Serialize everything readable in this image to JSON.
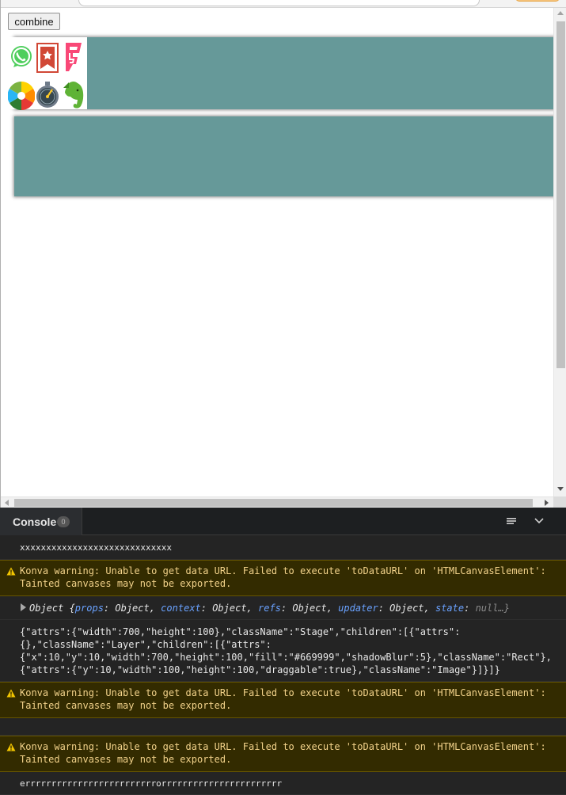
{
  "preview": {
    "combine_button_label": "combine",
    "canvas_rect_color": "#669999",
    "icons": [
      "whatsapp-icon",
      "wunderlist-icon",
      "foursquare-icon",
      "pinwheel-icon",
      "clock-icon",
      "evernote-icon"
    ]
  },
  "console": {
    "title": "Console",
    "count": "0",
    "messages": [
      {
        "type": "log",
        "text": "xxxxxxxxxxxxxxxxxxxxxxxxxxxxx"
      },
      {
        "type": "warn",
        "line1": "Konva warning: Unable to get data URL. Failed to execute 'toDataURL' on 'HTMLCanvasElement':",
        "line2": "Tainted canvases may not be exported."
      },
      {
        "type": "object",
        "prefix": "Object {",
        "k1": "props",
        "v1": ": Object, ",
        "k2": "context",
        "v2": ": Object, ",
        "k3": "refs",
        "v3": ": Object, ",
        "k4": "updater",
        "v4": ": Object, ",
        "k5": "state",
        "v5": ": ",
        "null": "null…}"
      },
      {
        "type": "log",
        "line1": "{\"attrs\":{\"width\":700,\"height\":100},\"className\":\"Stage\",\"children\":[{\"attrs\":",
        "line2": "{},\"className\":\"Layer\",\"children\":[{\"attrs\":",
        "line3": "{\"x\":10,\"y\":10,\"width\":700,\"height\":100,\"fill\":\"#669999\",\"shadowBlur\":5},\"className\":\"Rect\"},",
        "line4": "{\"attrs\":{\"y\":10,\"width\":100,\"height\":100,\"draggable\":true},\"className\":\"Image\"}]}]}"
      },
      {
        "type": "warn",
        "line1": "Konva warning: Unable to get data URL. Failed to execute 'toDataURL' on 'HTMLCanvasElement':",
        "line2": "Tainted canvases may not be exported."
      },
      {
        "type": "warn",
        "line1": "Konva warning: Unable to get data URL. Failed to execute 'toDataURL' on 'HTMLCanvasElement':",
        "line2": "Tainted canvases may not be exported."
      },
      {
        "type": "log",
        "text": "errrrrrrrrrrrrrrrrrrrrrrrrorrrrrrrrrrrrrrrrrrrrrrr"
      }
    ]
  }
}
